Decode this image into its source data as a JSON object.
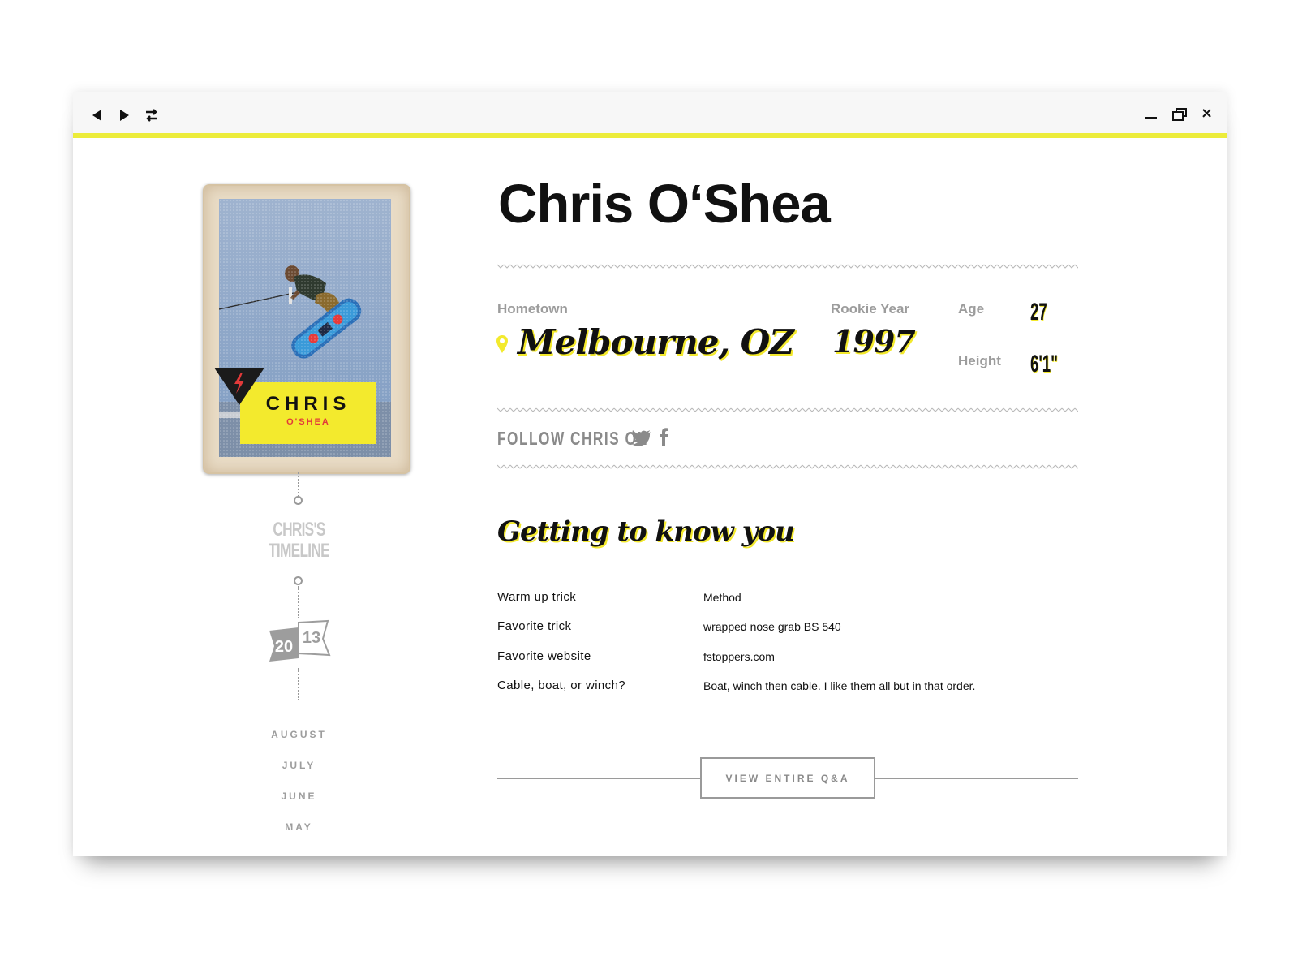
{
  "browser": {
    "icons": [
      "back-arrow-icon",
      "forward-arrow-icon",
      "reload-icon",
      "minimize-icon",
      "restore-icon",
      "close-icon"
    ],
    "close_glyph": "×"
  },
  "colors": {
    "accent_yellow": "#f3ea2d",
    "accent_red": "#e23a3a",
    "muted_gray": "#9c9c9c"
  },
  "card": {
    "first_name": "CHRIS",
    "last_name": "O'SHEA"
  },
  "timeline": {
    "title_line1": "CHRIS'S",
    "title_line2": "TIMELINE",
    "year_part1": "20",
    "year_part2": "13",
    "months": [
      "AUGUST",
      "JULY",
      "JUNE",
      "MAY"
    ]
  },
  "profile": {
    "name": "Chris O‘Shea",
    "hometown_label": "Hometown",
    "hometown_value": "Melbourne, OZ",
    "rookie_label": "Rookie Year",
    "rookie_value": "1997",
    "age_label": "Age",
    "age_value": "27",
    "height_label": "Height",
    "height_value": "6'1\""
  },
  "follow": {
    "label": "FOLLOW CHRIS ON",
    "networks": [
      "twitter-icon",
      "facebook-icon"
    ]
  },
  "qa": {
    "heading": "Getting to know you",
    "rows": [
      {
        "question": "Warm up trick",
        "answer": "Method"
      },
      {
        "question": "Favorite trick",
        "answer": "wrapped nose grab BS 540"
      },
      {
        "question": "Favorite website",
        "answer": "fstoppers.com"
      },
      {
        "question": "Cable, boat, or winch?",
        "answer": "Boat, winch then cable. I like them all but in that order."
      }
    ],
    "button_label": "VIEW ENTIRE Q&A"
  }
}
